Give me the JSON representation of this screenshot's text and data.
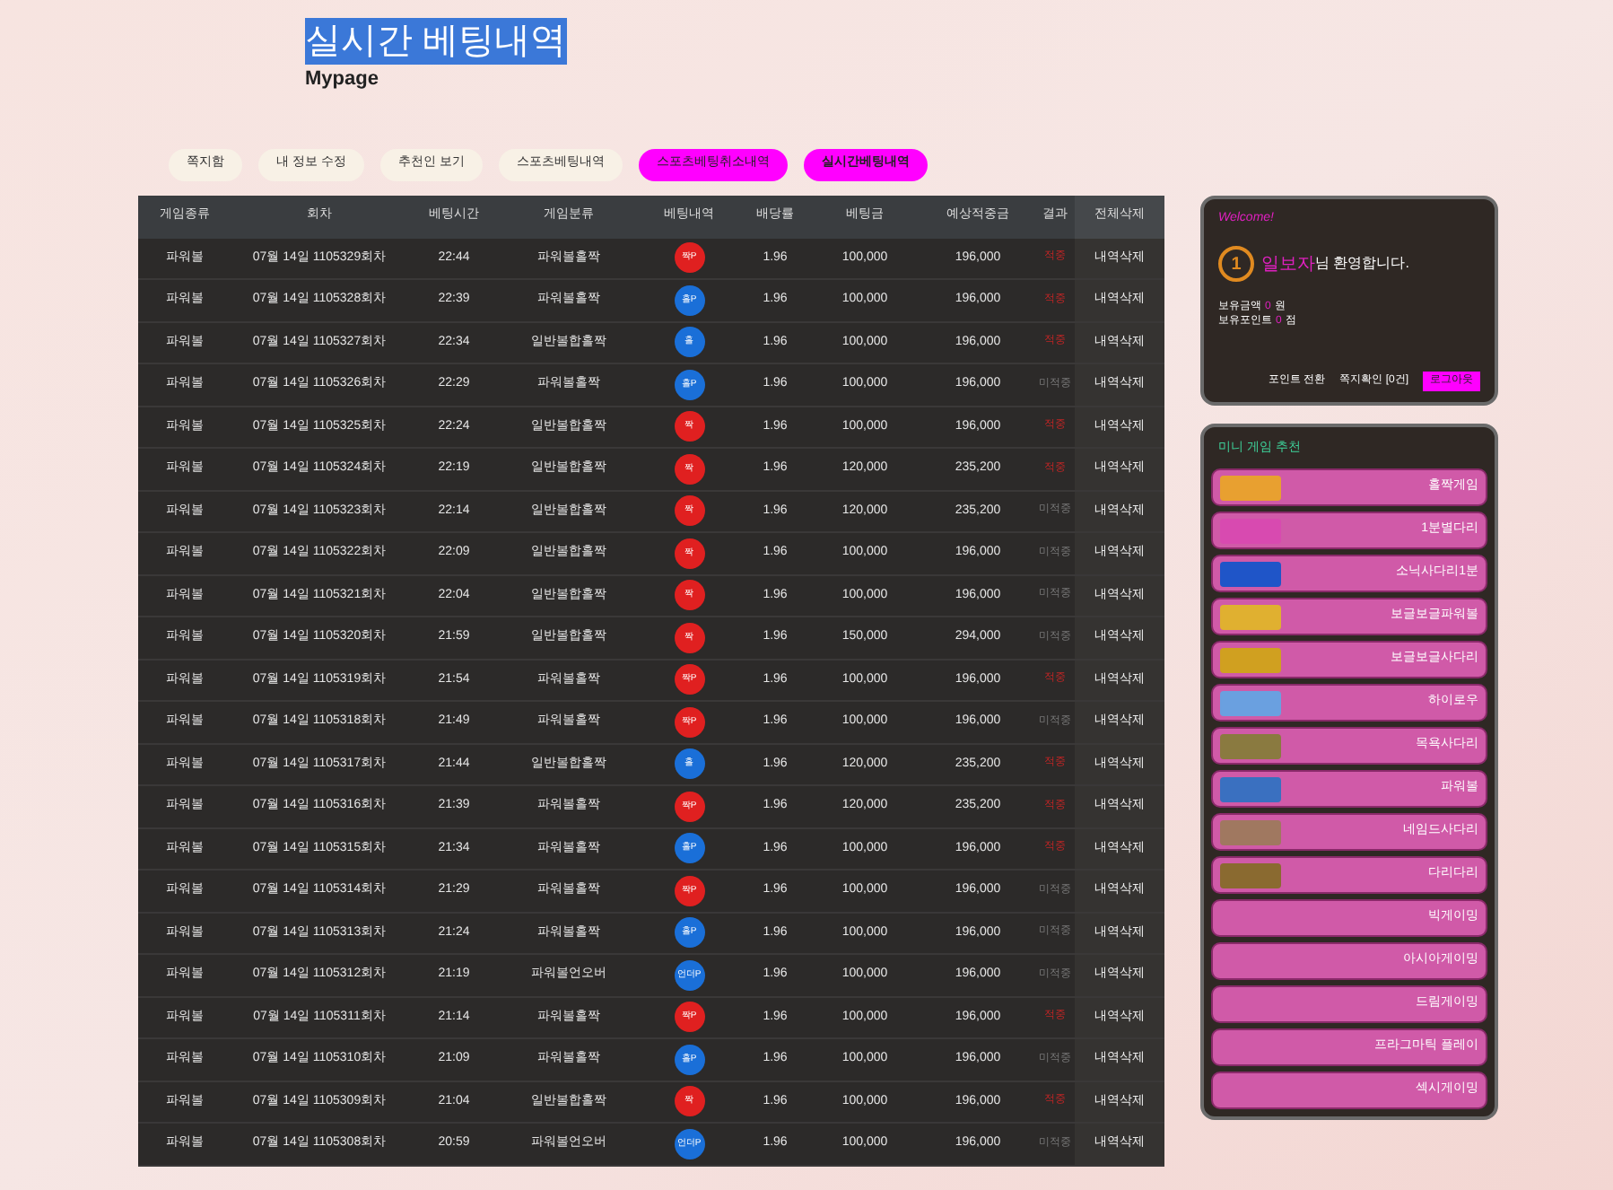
{
  "header": {
    "title": "실시간 베팅내역",
    "subtitle": "Mypage"
  },
  "nav": [
    {
      "label": "쪽지함",
      "selected": false,
      "kind": "plain"
    },
    {
      "label": "내 정보 수정",
      "selected": false,
      "kind": "plain"
    },
    {
      "label": "추천인 보기",
      "selected": false,
      "kind": "plain"
    },
    {
      "label": "스포츠베팅내역",
      "selected": false,
      "kind": "plain"
    },
    {
      "label": "스포츠베팅취소내역",
      "selected": false,
      "kind": "accent"
    },
    {
      "label": "실시간베팅내역",
      "selected": true,
      "kind": "accent"
    }
  ],
  "table": {
    "columns": [
      "게임종류",
      "회차",
      "베팅시간",
      "게임분류",
      "베팅내역",
      "배당률",
      "베팅금",
      "예상적중금",
      "결과",
      "전체삭제"
    ],
    "rows": [
      {
        "game": "파워볼",
        "round": "07월 14일 1105329회차",
        "time": "22:44",
        "category": "파워볼홀짝",
        "pick": "짝P",
        "color": "#e02020",
        "odds": "1.96",
        "bet": "100,000",
        "payout": "196,000",
        "result": "적중",
        "won": true,
        "action": "내역삭제"
      },
      {
        "game": "파워볼",
        "round": "07월 14일 1105328회차",
        "time": "22:39",
        "category": "파워볼홀짝",
        "pick": "홀P",
        "color": "#1a6fd8",
        "odds": "1.96",
        "bet": "100,000",
        "payout": "196,000",
        "result": "적중",
        "won": true,
        "action": "내역삭제"
      },
      {
        "game": "파워볼",
        "round": "07월 14일 1105327회차",
        "time": "22:34",
        "category": "일반볼합홀짝",
        "pick": "홀",
        "color": "#1a6fd8",
        "odds": "1.96",
        "bet": "100,000",
        "payout": "196,000",
        "result": "적중",
        "won": true,
        "action": "내역삭제"
      },
      {
        "game": "파워볼",
        "round": "07월 14일 1105326회차",
        "time": "22:29",
        "category": "파워볼홀짝",
        "pick": "홀P",
        "color": "#1a6fd8",
        "odds": "1.96",
        "bet": "100,000",
        "payout": "196,000",
        "result": "미적중",
        "won": false,
        "action": "내역삭제"
      },
      {
        "game": "파워볼",
        "round": "07월 14일 1105325회차",
        "time": "22:24",
        "category": "일반볼합홀짝",
        "pick": "짝",
        "color": "#e02020",
        "odds": "1.96",
        "bet": "100,000",
        "payout": "196,000",
        "result": "적중",
        "won": true,
        "action": "내역삭제"
      },
      {
        "game": "파워볼",
        "round": "07월 14일 1105324회차",
        "time": "22:19",
        "category": "일반볼합홀짝",
        "pick": "짝",
        "color": "#e02020",
        "odds": "1.96",
        "bet": "120,000",
        "payout": "235,200",
        "result": "적중",
        "won": true,
        "action": "내역삭제"
      },
      {
        "game": "파워볼",
        "round": "07월 14일 1105323회차",
        "time": "22:14",
        "category": "일반볼합홀짝",
        "pick": "짝",
        "color": "#e02020",
        "odds": "1.96",
        "bet": "120,000",
        "payout": "235,200",
        "result": "미적중",
        "won": false,
        "action": "내역삭제"
      },
      {
        "game": "파워볼",
        "round": "07월 14일 1105322회차",
        "time": "22:09",
        "category": "일반볼합홀짝",
        "pick": "짝",
        "color": "#e02020",
        "odds": "1.96",
        "bet": "100,000",
        "payout": "196,000",
        "result": "미적중",
        "won": false,
        "action": "내역삭제"
      },
      {
        "game": "파워볼",
        "round": "07월 14일 1105321회차",
        "time": "22:04",
        "category": "일반볼합홀짝",
        "pick": "짝",
        "color": "#e02020",
        "odds": "1.96",
        "bet": "100,000",
        "payout": "196,000",
        "result": "미적중",
        "won": false,
        "action": "내역삭제"
      },
      {
        "game": "파워볼",
        "round": "07월 14일 1105320회차",
        "time": "21:59",
        "category": "일반볼합홀짝",
        "pick": "짝",
        "color": "#e02020",
        "odds": "1.96",
        "bet": "150,000",
        "payout": "294,000",
        "result": "미적중",
        "won": false,
        "action": "내역삭제"
      },
      {
        "game": "파워볼",
        "round": "07월 14일 1105319회차",
        "time": "21:54",
        "category": "파워볼홀짝",
        "pick": "짝P",
        "color": "#e02020",
        "odds": "1.96",
        "bet": "100,000",
        "payout": "196,000",
        "result": "적중",
        "won": true,
        "action": "내역삭제"
      },
      {
        "game": "파워볼",
        "round": "07월 14일 1105318회차",
        "time": "21:49",
        "category": "파워볼홀짝",
        "pick": "짝P",
        "color": "#e02020",
        "odds": "1.96",
        "bet": "100,000",
        "payout": "196,000",
        "result": "미적중",
        "won": false,
        "action": "내역삭제"
      },
      {
        "game": "파워볼",
        "round": "07월 14일 1105317회차",
        "time": "21:44",
        "category": "일반볼합홀짝",
        "pick": "홀",
        "color": "#1a6fd8",
        "odds": "1.96",
        "bet": "120,000",
        "payout": "235,200",
        "result": "적중",
        "won": true,
        "action": "내역삭제"
      },
      {
        "game": "파워볼",
        "round": "07월 14일 1105316회차",
        "time": "21:39",
        "category": "파워볼홀짝",
        "pick": "짝P",
        "color": "#e02020",
        "odds": "1.96",
        "bet": "120,000",
        "payout": "235,200",
        "result": "적중",
        "won": true,
        "action": "내역삭제"
      },
      {
        "game": "파워볼",
        "round": "07월 14일 1105315회차",
        "time": "21:34",
        "category": "파워볼홀짝",
        "pick": "홀P",
        "color": "#1a6fd8",
        "odds": "1.96",
        "bet": "100,000",
        "payout": "196,000",
        "result": "적중",
        "won": true,
        "action": "내역삭제"
      },
      {
        "game": "파워볼",
        "round": "07월 14일 1105314회차",
        "time": "21:29",
        "category": "파워볼홀짝",
        "pick": "짝P",
        "color": "#e02020",
        "odds": "1.96",
        "bet": "100,000",
        "payout": "196,000",
        "result": "미적중",
        "won": false,
        "action": "내역삭제"
      },
      {
        "game": "파워볼",
        "round": "07월 14일 1105313회차",
        "time": "21:24",
        "category": "파워볼홀짝",
        "pick": "홀P",
        "color": "#1a6fd8",
        "odds": "1.96",
        "bet": "100,000",
        "payout": "196,000",
        "result": "미적중",
        "won": false,
        "action": "내역삭제"
      },
      {
        "game": "파워볼",
        "round": "07월 14일 1105312회차",
        "time": "21:19",
        "category": "파워볼언오버",
        "pick": "언더P",
        "color": "#1a6fd8",
        "odds": "1.96",
        "bet": "100,000",
        "payout": "196,000",
        "result": "미적중",
        "won": false,
        "action": "내역삭제"
      },
      {
        "game": "파워볼",
        "round": "07월 14일 1105311회차",
        "time": "21:14",
        "category": "파워볼홀짝",
        "pick": "짝P",
        "color": "#e02020",
        "odds": "1.96",
        "bet": "100,000",
        "payout": "196,000",
        "result": "적중",
        "won": true,
        "action": "내역삭제"
      },
      {
        "game": "파워볼",
        "round": "07월 14일 1105310회차",
        "time": "21:09",
        "category": "파워볼홀짝",
        "pick": "홀P",
        "color": "#1a6fd8",
        "odds": "1.96",
        "bet": "100,000",
        "payout": "196,000",
        "result": "미적중",
        "won": false,
        "action": "내역삭제"
      },
      {
        "game": "파워볼",
        "round": "07월 14일 1105309회차",
        "time": "21:04",
        "category": "일반볼합홀짝",
        "pick": "짝",
        "color": "#e02020",
        "odds": "1.96",
        "bet": "100,000",
        "payout": "196,000",
        "result": "적중",
        "won": true,
        "action": "내역삭제"
      },
      {
        "game": "파워볼",
        "round": "07월 14일 1105308회차",
        "time": "20:59",
        "category": "파워볼언오버",
        "pick": "언더P",
        "color": "#1a6fd8",
        "odds": "1.96",
        "bet": "100,000",
        "payout": "196,000",
        "result": "미적중",
        "won": false,
        "action": "내역삭제"
      }
    ]
  },
  "welcome": {
    "title": "Welcome!",
    "level": "1",
    "user_name": "일보자",
    "greeting": "님 환영합니다.",
    "balance_label": "보유금액",
    "balance": "0",
    "balance_unit": "원",
    "points_label": "보유포인트",
    "points": "0",
    "points_unit": "점",
    "buttons": [
      {
        "label": "포인트 전환",
        "kind": "plain"
      },
      {
        "label": "쪽지확인 [0건]",
        "kind": "plain"
      },
      {
        "label": "로그아웃",
        "kind": "accent"
      }
    ]
  },
  "mini_games": {
    "title": "미니 게임 추천",
    "items": [
      {
        "label": "홀짝게임",
        "logo": true
      },
      {
        "label": "1분별다리",
        "logo": true
      },
      {
        "label": "소닉사다리1분",
        "logo": true
      },
      {
        "label": "보글보글파워볼",
        "logo": true
      },
      {
        "label": "보글보글사다리",
        "logo": true
      },
      {
        "label": "하이로우",
        "logo": true
      },
      {
        "label": "목욕사다리",
        "logo": true
      },
      {
        "label": "파워볼",
        "logo": true
      },
      {
        "label": "네임드사다리",
        "logo": true
      },
      {
        "label": "다리다리",
        "logo": true
      },
      {
        "label": "빅게이밍",
        "logo": false
      },
      {
        "label": "아시아게이밍",
        "logo": false
      },
      {
        "label": "드림게이밍",
        "logo": false
      },
      {
        "label": "프라그마틱 플레이",
        "logo": false
      },
      {
        "label": "섹시게이밍",
        "logo": false
      }
    ]
  }
}
